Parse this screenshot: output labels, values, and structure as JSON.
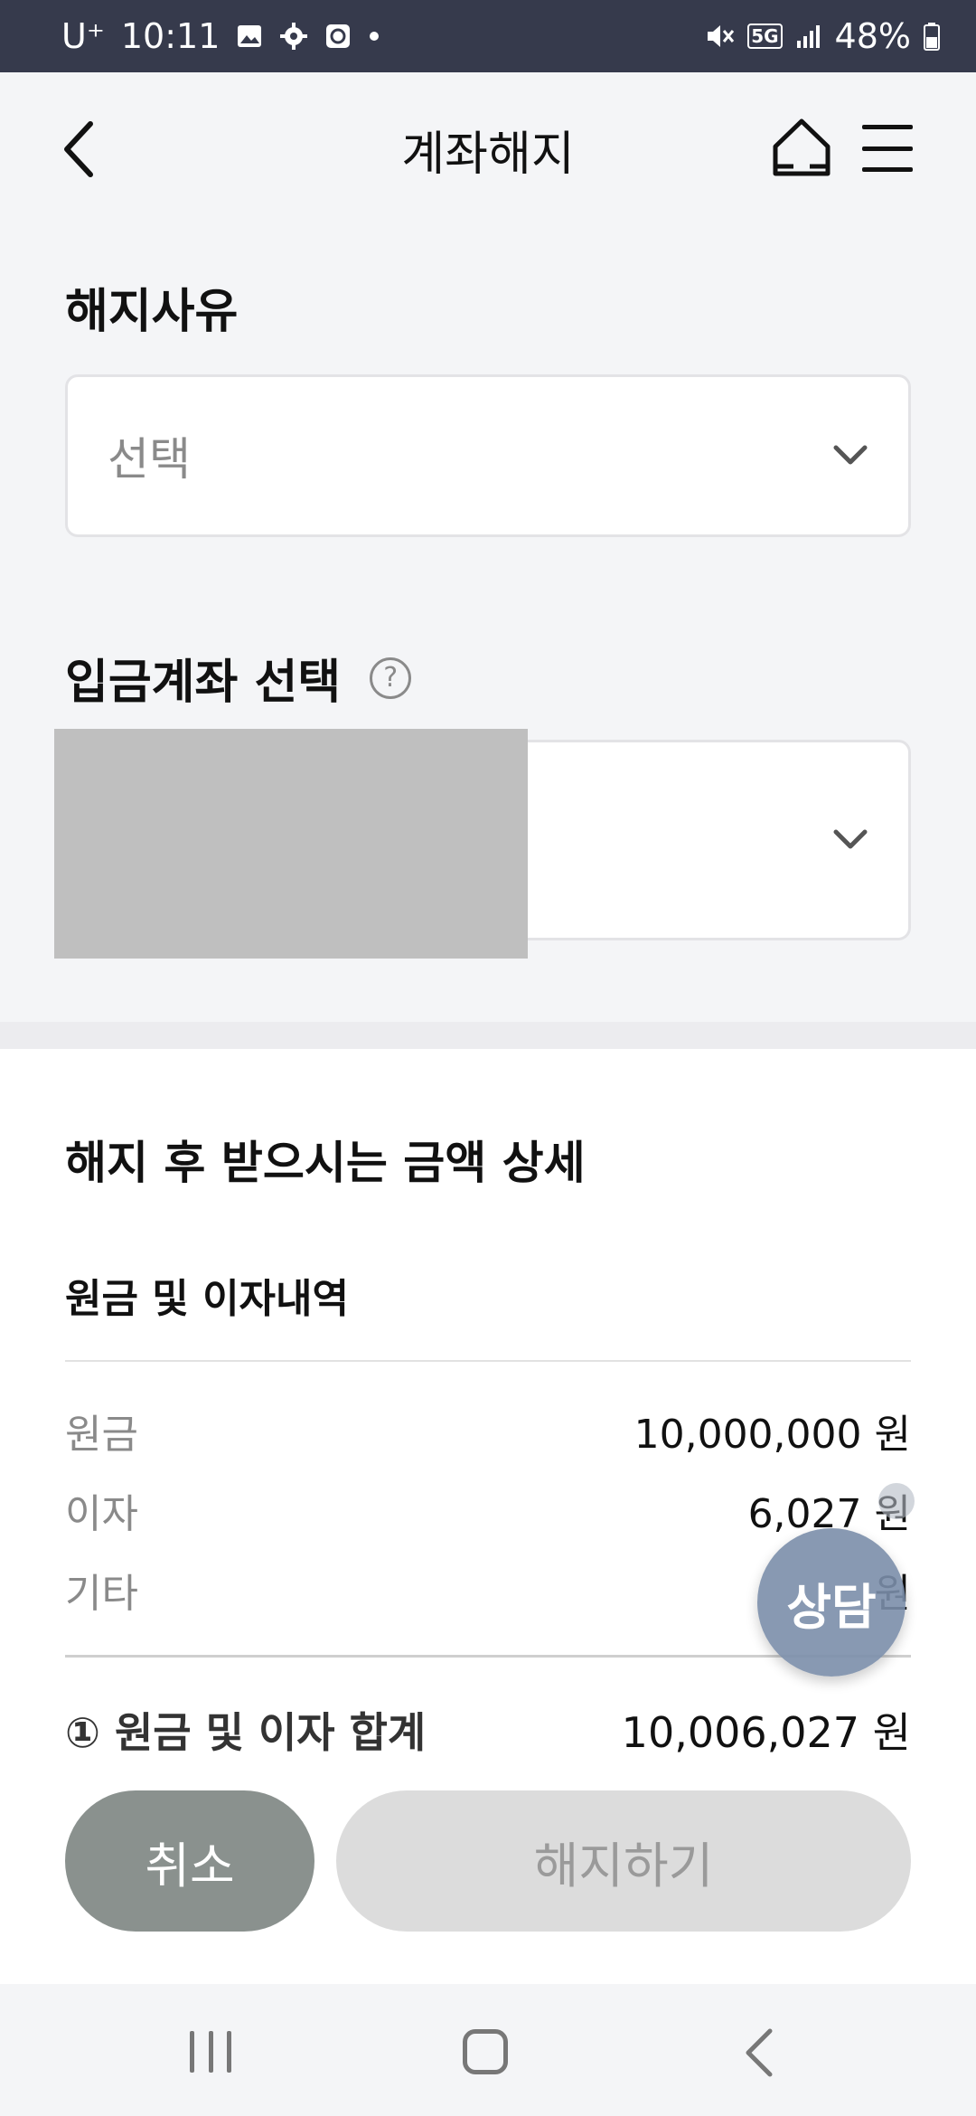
{
  "status_bar": {
    "carrier": "U⁺",
    "time": "10:11",
    "network": "5G",
    "battery": "48%"
  },
  "header": {
    "title": "계좌해지"
  },
  "reason": {
    "label": "해지사유",
    "placeholder": "선택"
  },
  "deposit_account": {
    "label": "입금계좌 선택",
    "help": "?"
  },
  "details": {
    "title": "해지 후 받으시는 금액 상세",
    "subtitle": "원금 및 이자내역",
    "rows": [
      {
        "label": "원금",
        "value": "10,000,000 원"
      },
      {
        "label": "이자",
        "value": "6,027 원"
      },
      {
        "label": "기타",
        "value": "원"
      }
    ],
    "total": {
      "label": "① 원금 및 이자 합계",
      "value": "10,006,027 원"
    }
  },
  "buttons": {
    "cancel": "취소",
    "terminate": "해지하기"
  },
  "fab": {
    "label": "상담"
  },
  "colors": {
    "status_bar_bg": "#363a4c",
    "cancel_bg": "#8a918e",
    "terminate_bg": "#dcdcdc",
    "fab_bg": "#7b8eaa"
  }
}
